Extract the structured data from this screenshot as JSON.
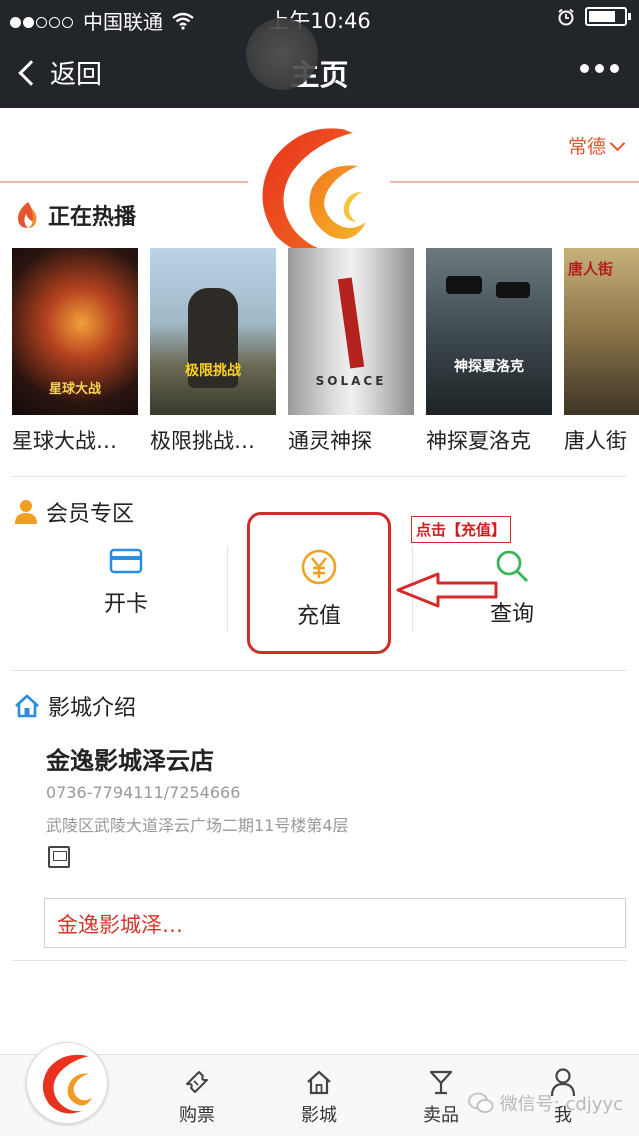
{
  "status_bar": {
    "carrier": "中国联通",
    "time": "上午10:46",
    "signal_bars_filled": 2,
    "signal_bars_total": 5
  },
  "nav": {
    "back_label": "返回",
    "title": "主页"
  },
  "header": {
    "city": "常德"
  },
  "now_showing": {
    "title": "正在热播",
    "movies": [
      {
        "caption": "星球大战…",
        "poster_text": "星球大战"
      },
      {
        "caption": "极限挑战…",
        "poster_text": "极限挑战"
      },
      {
        "caption": "通灵神探",
        "poster_text": "SOLACE"
      },
      {
        "caption": "神探夏洛克",
        "poster_text": "神探夏洛克"
      },
      {
        "caption": "唐人街",
        "poster_text": "唐人街"
      }
    ]
  },
  "member": {
    "title": "会员专区",
    "items": [
      {
        "label": "开卡",
        "icon": "card-icon"
      },
      {
        "label": "充值",
        "icon": "yuan-icon"
      },
      {
        "label": "查询",
        "icon": "search-icon"
      }
    ]
  },
  "annotation": {
    "label": "点击【充值】"
  },
  "cinema": {
    "title": "影城介绍",
    "name": "金逸影城泽云店",
    "phone": "0736-7794111/7254666",
    "address": "武陵区武陵大道泽云广场二期11号楼第4层",
    "store_button": "金逸影城泽…"
  },
  "tabbar": {
    "items": [
      {
        "label": "购票",
        "icon": "ticket-icon"
      },
      {
        "label": "影城",
        "icon": "home-icon"
      },
      {
        "label": "卖品",
        "icon": "cocktail-icon"
      },
      {
        "label": "我",
        "icon": "user-icon"
      }
    ]
  },
  "watermark": "微信号: cdjyyc",
  "colors": {
    "accent": "#e4572e",
    "nav_bg": "#222529",
    "annotation": "#d42a2a",
    "icon_blue": "#2a8ee0",
    "icon_orange": "#f0a020",
    "icon_green": "#3cb55a"
  }
}
